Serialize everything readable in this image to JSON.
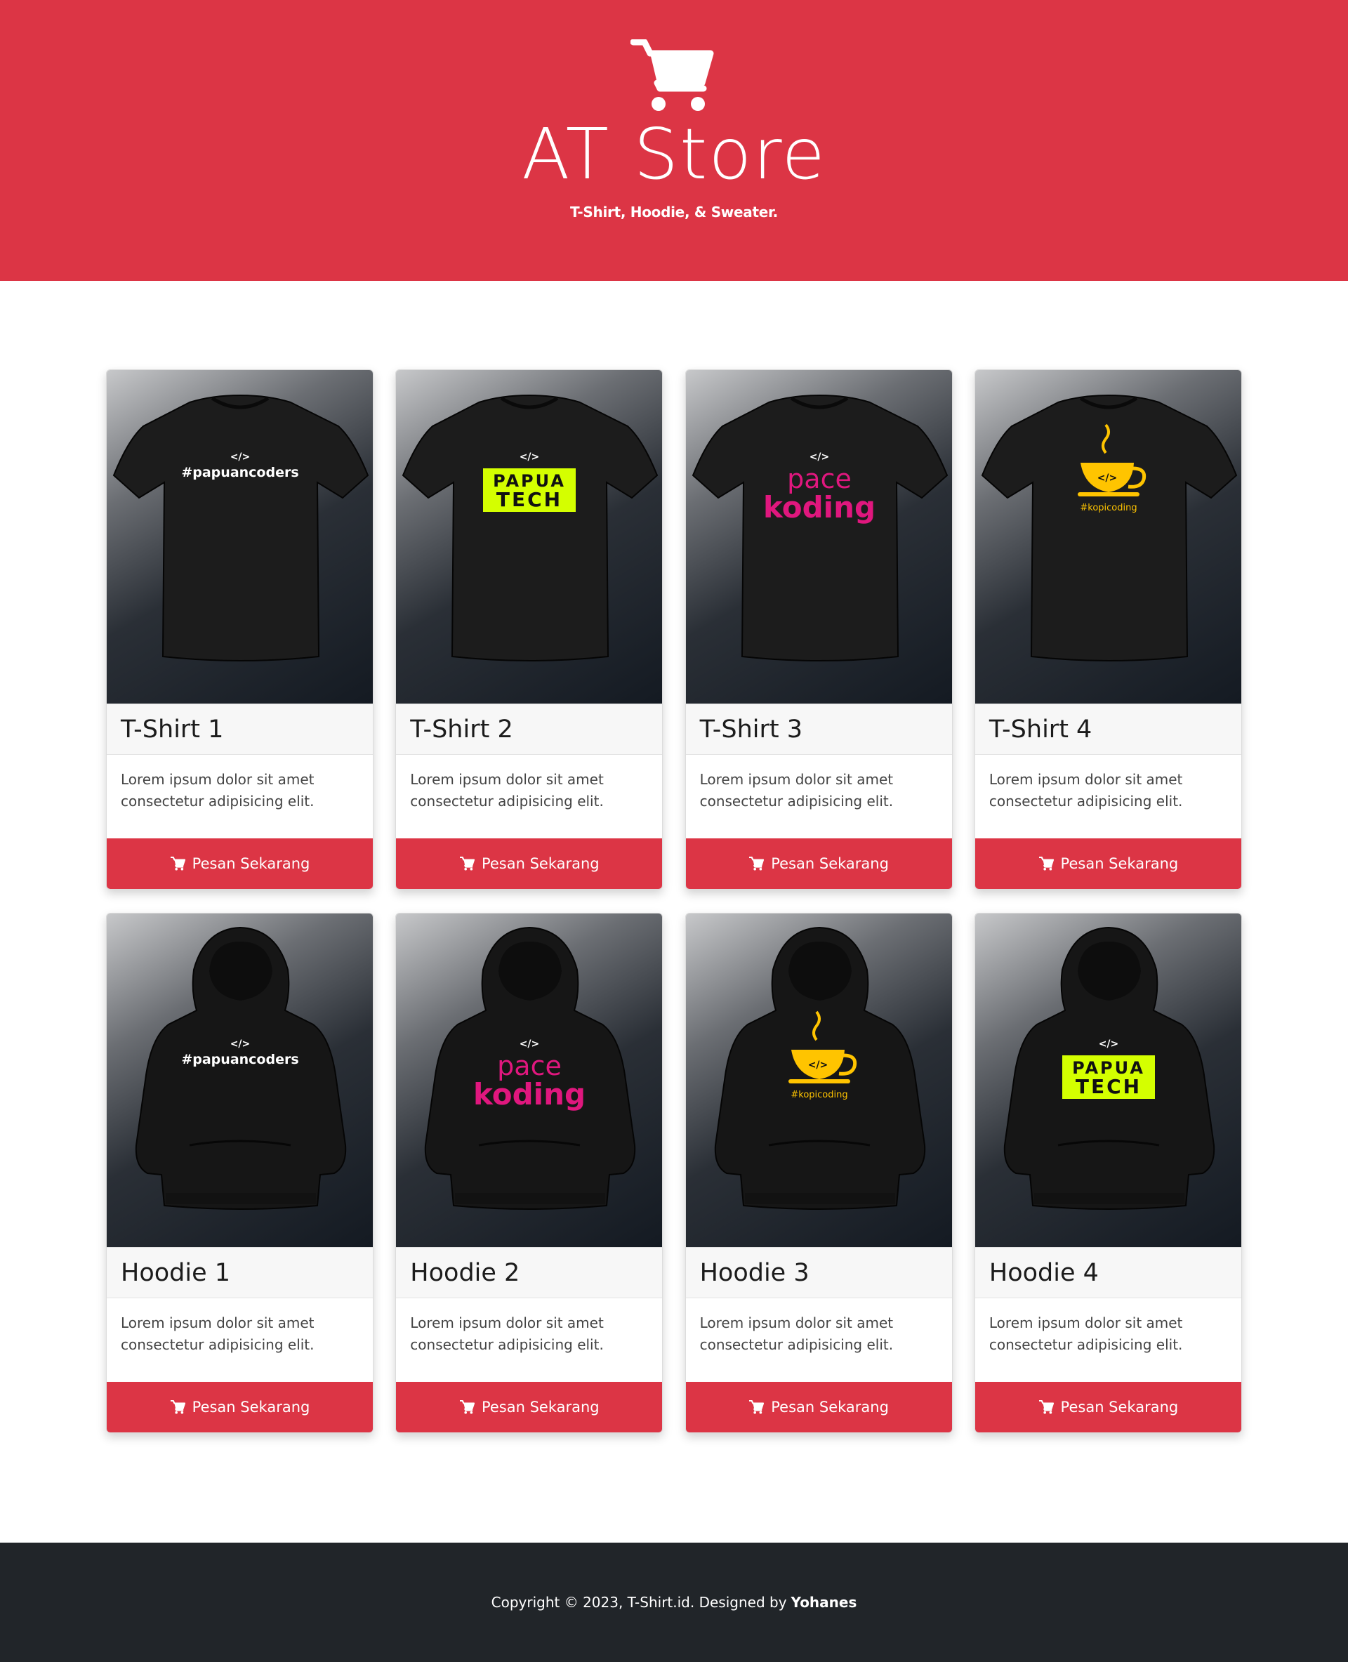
{
  "header": {
    "title": "AT Store",
    "tagline": "T-Shirt, Hoodie, & Sweater.",
    "logo_icon": "shopping-cart-icon",
    "background_color": "#dc3545"
  },
  "products": [
    {
      "name": "T-Shirt 1",
      "type": "tshirt",
      "print": "papuancoders",
      "print_text": "#papuancoders",
      "description": "Lorem ipsum dolor sit amet consectetur adipisicing elit.",
      "button_label": "Pesan Sekarang"
    },
    {
      "name": "T-Shirt 2",
      "type": "tshirt",
      "print": "papuatech",
      "print_text": "PAPUA TECH",
      "description": "Lorem ipsum dolor sit amet consectetur adipisicing elit.",
      "button_label": "Pesan Sekarang"
    },
    {
      "name": "T-Shirt 3",
      "type": "tshirt",
      "print": "pacekoding",
      "print_text": "pace koding",
      "description": "Lorem ipsum dolor sit amet consectetur adipisicing elit.",
      "button_label": "Pesan Sekarang"
    },
    {
      "name": "T-Shirt 4",
      "type": "tshirt",
      "print": "kopicoding",
      "print_text": "#kopicoding",
      "description": "Lorem ipsum dolor sit amet consectetur adipisicing elit.",
      "button_label": "Pesan Sekarang"
    },
    {
      "name": "Hoodie 1",
      "type": "hoodie",
      "print": "papuancoders",
      "print_text": "#papuancoders",
      "description": "Lorem ipsum dolor sit amet consectetur adipisicing elit.",
      "button_label": "Pesan Sekarang"
    },
    {
      "name": "Hoodie 2",
      "type": "hoodie",
      "print": "pacekoding",
      "print_text": "pace koding",
      "description": "Lorem ipsum dolor sit amet consectetur adipisicing elit.",
      "button_label": "Pesan Sekarang"
    },
    {
      "name": "Hoodie 3",
      "type": "hoodie",
      "print": "kopicoding",
      "print_text": "#kopicoding",
      "description": "Lorem ipsum dolor sit amet consectetur adipisicing elit.",
      "button_label": "Pesan Sekarang"
    },
    {
      "name": "Hoodie 4",
      "type": "hoodie",
      "print": "papuatech",
      "print_text": "PAPUA TECH",
      "description": "Lorem ipsum dolor sit amet consectetur adipisicing elit.",
      "button_label": "Pesan Sekarang"
    }
  ],
  "footer": {
    "copyright": "Copyright © 2023, T-Shirt.id. Designed by",
    "author": "Yohanes"
  },
  "colors": {
    "accent": "#dc3545",
    "footer_bg": "#212529",
    "print_lime": "#d4ff00",
    "print_pink": "#e0177e",
    "print_yellow": "#ffc400"
  }
}
